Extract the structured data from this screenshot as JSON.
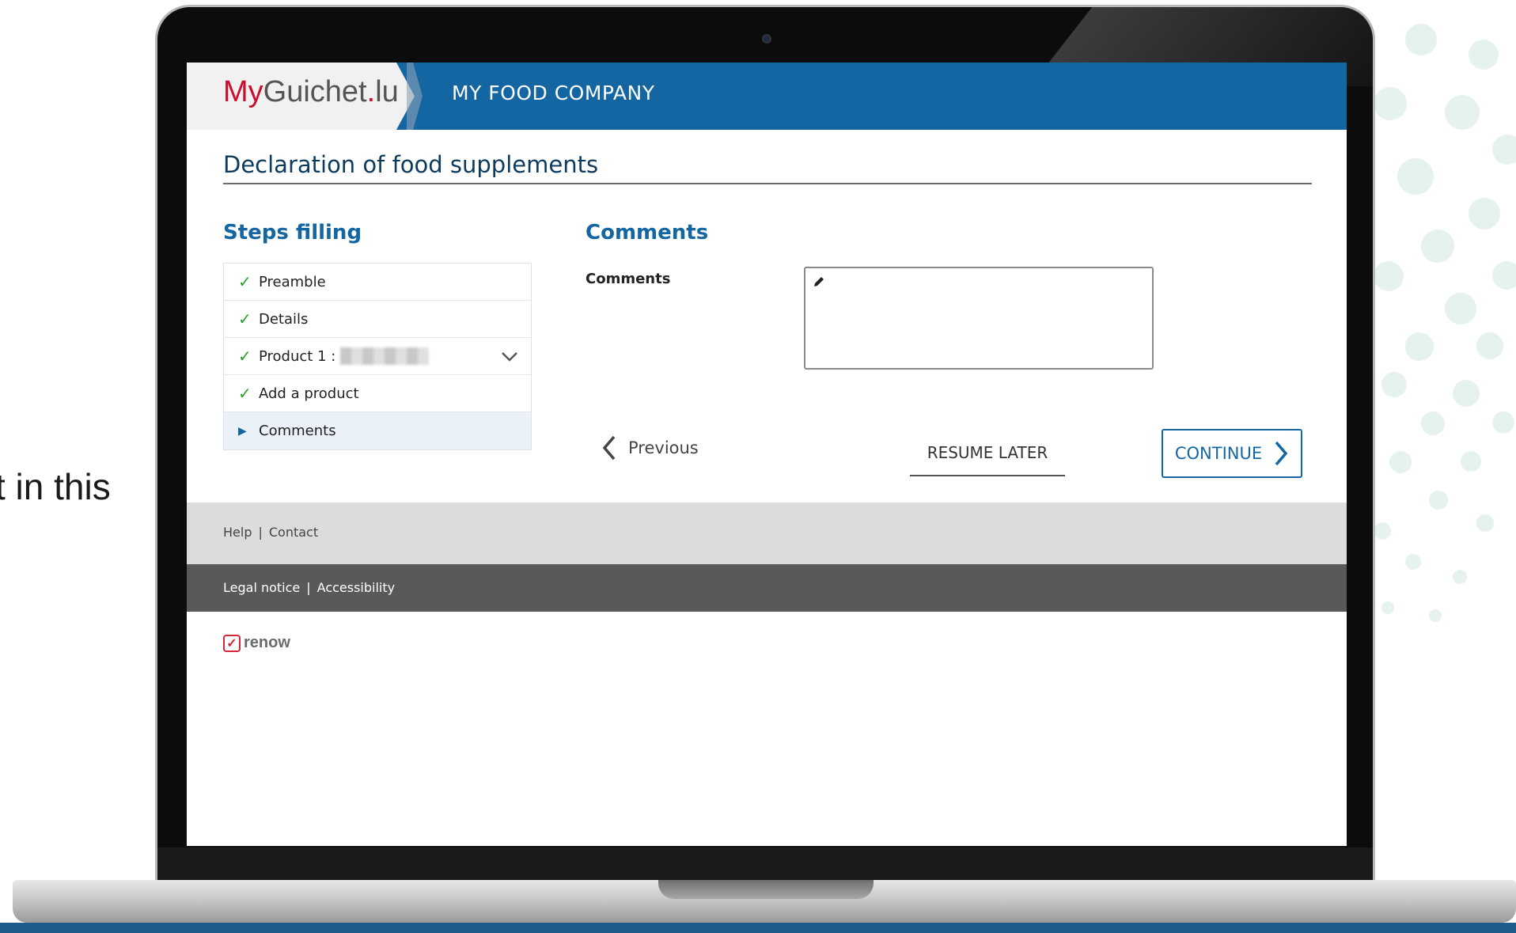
{
  "side_text": "t in this",
  "header": {
    "brand": {
      "part1": "My",
      "part2": "Guichet",
      "part3": ".",
      "part4": "lu"
    },
    "company": "MY FOOD COMPANY"
  },
  "page_title": "Declaration of food supplements",
  "steps": {
    "heading": "Steps filling",
    "items": [
      {
        "label": "Preamble",
        "status": "done"
      },
      {
        "label": "Details",
        "status": "done"
      },
      {
        "label": "Product 1 :",
        "status": "done"
      },
      {
        "label": "Add a product",
        "status": "done"
      },
      {
        "label": "Comments",
        "status": "current"
      }
    ]
  },
  "comments": {
    "heading": "Comments",
    "field_label": "Comments",
    "value": ""
  },
  "buttons": {
    "previous": "Previous",
    "resume_later": "RESUME LATER",
    "continue": "CONTINUE"
  },
  "footer": {
    "help": "Help",
    "contact": "Contact",
    "separator": "|",
    "legal_notice": "Legal notice",
    "accessibility": "Accessibility",
    "logo": "renow"
  },
  "colors": {
    "primary": "#1466a3",
    "title": "#0d3b5e",
    "check": "#2aa12a",
    "brand_red": "#c8102e",
    "footer_light": "#dcdcdc",
    "footer_dark": "#58595b"
  }
}
